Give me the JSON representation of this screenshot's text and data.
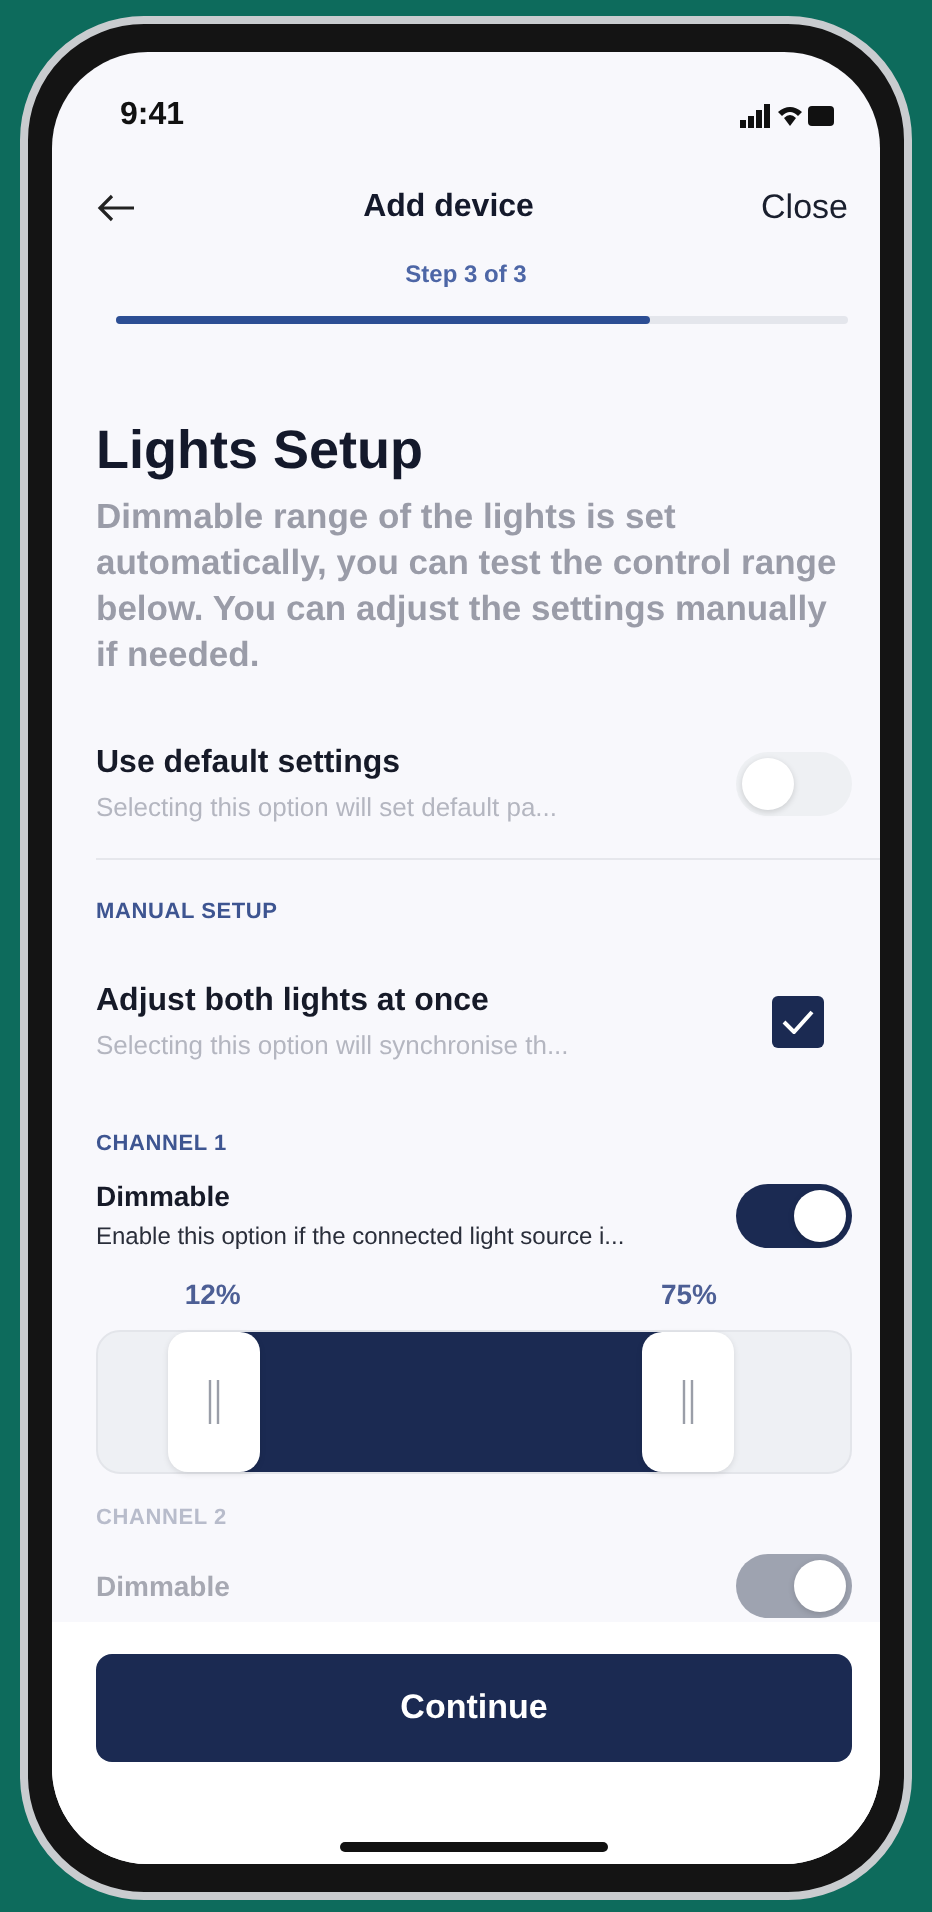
{
  "status_bar": {
    "time": "9:41"
  },
  "header": {
    "title": "Add device",
    "close": "Close"
  },
  "stepper": {
    "label": "Step 3 of 3",
    "level": 0.73
  },
  "title": "Lights Setup",
  "description": "Dimmable range of the lights is set automatically, you can test the control range below. You can adjust the settings manually if needed.",
  "default_settings": {
    "label": "Use default settings",
    "hint": "Selecting this option will set default pa...",
    "on": false
  },
  "manual_setup": {
    "heading": "MANUAL SETUP",
    "sync": {
      "label": "Adjust both lights at once",
      "hint": "Selecting this option will synchronise th...",
      "checked": true
    }
  },
  "channels": [
    {
      "heading": "CHANNEL 1",
      "label": "Dimmable",
      "hint": "Enable this option if the connected light source i...",
      "on": true,
      "disabled": false,
      "range": {
        "low": {
          "level": 0.12,
          "reading": "12%"
        },
        "high": {
          "level": 0.75,
          "reading": "75%"
        }
      }
    },
    {
      "heading": "CHANNEL 2",
      "label": "Dimmable",
      "on": true,
      "disabled": true
    }
  ],
  "continue_button": "Continue"
}
